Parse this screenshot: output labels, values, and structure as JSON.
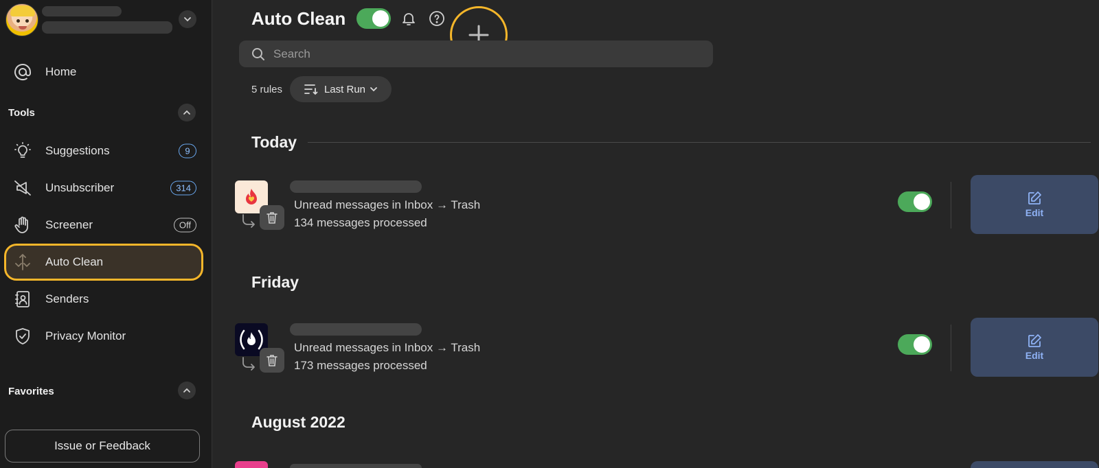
{
  "sidebar": {
    "nav": {
      "home": "Home"
    },
    "tools_section": "Tools",
    "tools": [
      {
        "label": "Suggestions",
        "badge": "9"
      },
      {
        "label": "Unsubscriber",
        "badge": "314"
      },
      {
        "label": "Screener",
        "badge": "Off"
      },
      {
        "label": "Auto Clean"
      },
      {
        "label": "Senders"
      },
      {
        "label": "Privacy Monitor"
      }
    ],
    "favorites_section": "Favorites",
    "feedback_button": "Issue or Feedback"
  },
  "main": {
    "title": "Auto Clean",
    "search_placeholder": "Search",
    "rules_count": "5 rules",
    "sort_label": "Last Run",
    "groups": [
      {
        "heading": "Today",
        "rule": {
          "description": "Unread messages in Inbox → Trash",
          "processed": "134 messages processed",
          "edit_label": "Edit"
        }
      },
      {
        "heading": "Friday",
        "rule": {
          "description": "Unread messages in Inbox → Trash",
          "processed": "173 messages processed",
          "edit_label": "Edit"
        }
      },
      {
        "heading": "August 2022"
      }
    ]
  },
  "colors": {
    "accent_highlight": "#f5b62a",
    "toggle_on": "#4ca95a",
    "edit_button_bg": "#3c4a66",
    "badge_blue": "#6aa8f0"
  }
}
